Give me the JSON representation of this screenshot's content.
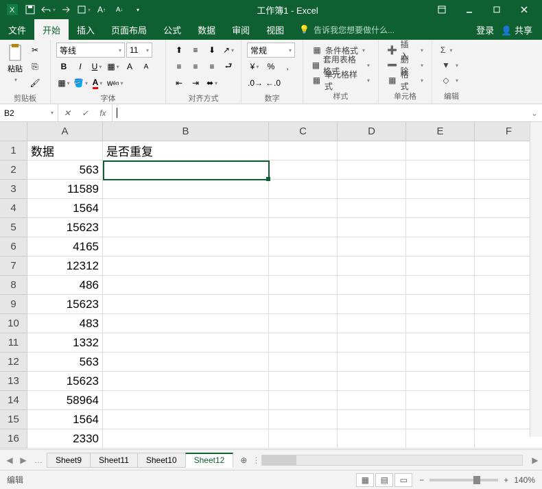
{
  "title": "工作簿1 - Excel",
  "qat_icons": [
    "excel",
    "save",
    "undo",
    "redo",
    "page",
    "fontsize-inc",
    "fontsize-dec"
  ],
  "win": {
    "login": "登录",
    "share": "共享"
  },
  "menu": {
    "file": "文件",
    "home": "开始",
    "insert": "插入",
    "layout": "页面布局",
    "formula": "公式",
    "data": "数据",
    "review": "审阅",
    "view": "视图",
    "tellme": "告诉我您想要做什么..."
  },
  "ribbon": {
    "clipboard": {
      "paste": "粘贴",
      "label": "剪贴板"
    },
    "font": {
      "name": "等线",
      "size": "11",
      "bold": "B",
      "italic": "I",
      "underline": "U",
      "label": "字体"
    },
    "align": {
      "label": "对齐方式",
      "wrap": "",
      "merge": ""
    },
    "number": {
      "format": "常规",
      "label": "数字"
    },
    "styles": {
      "cond": "条件格式",
      "table": "套用表格格式",
      "cell": "单元格样式",
      "label": "样式"
    },
    "cells": {
      "insert": "插入",
      "delete": "删除",
      "format": "格式",
      "label": "单元格"
    },
    "edit": {
      "sum": "Σ",
      "label": "编辑"
    }
  },
  "namebox": "B2",
  "formula": "",
  "cols": [
    "A",
    "B",
    "C",
    "D",
    "E",
    "F"
  ],
  "headers": {
    "A": "数据",
    "B": "是否重复"
  },
  "dataA": [
    "563",
    "11589",
    "1564",
    "15623",
    "4165",
    "12312",
    "486",
    "15623",
    "483",
    "1332",
    "563",
    "15623",
    "58964",
    "1564",
    "2330"
  ],
  "sheets": [
    "Sheet9",
    "Sheet11",
    "Sheet10",
    "Sheet12"
  ],
  "active_sheet": "Sheet12",
  "status": "编辑",
  "zoom": "140%"
}
